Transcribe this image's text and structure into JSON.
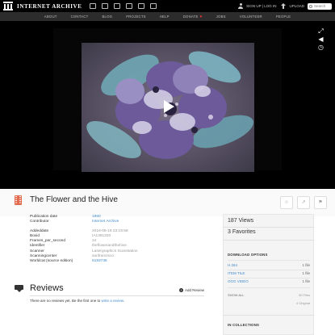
{
  "header": {
    "logo_text": "INTERNET ARCHIVE",
    "media_icons": [
      "web-icon",
      "texts-icon",
      "video-icon",
      "audio-icon",
      "software-icon",
      "images-icon"
    ],
    "signup_label": "SIGN UP | LOG IN",
    "upload_label": "UPLOAD",
    "search_placeholder": "Search"
  },
  "nav": {
    "items": [
      "ABOUT",
      "CONTACT",
      "BLOG",
      "PROJECTS",
      "HELP",
      "DONATE",
      "JOBS",
      "VOLUNTEER",
      "PEOPLE"
    ],
    "donate_heart": "♥"
  },
  "item": {
    "title": "The Flower and the Hive",
    "actions": [
      "favorite-icon",
      "share-icon",
      "flag-icon"
    ]
  },
  "metadata": [
    {
      "k": "Publication date",
      "v": "1960",
      "link": true
    },
    {
      "k": "Contributor",
      "v": "Internet Archive",
      "link": true
    },
    {
      "gap": true
    },
    {
      "k": "Addeddate",
      "v": "2018-08-19 23:19:58",
      "link": false
    },
    {
      "k": "Boxid",
      "v": "IA1381320",
      "link": false
    },
    {
      "k": "Frames_per_second",
      "v": "24",
      "link": false
    },
    {
      "k": "Identifier",
      "v": "theflowerandthehive",
      "link": false
    },
    {
      "k": "Scanner",
      "v": "Lasergraphics Scanstation",
      "link": false
    },
    {
      "k": "Scanningcenter",
      "v": "sanfrancisco",
      "link": false
    },
    {
      "k": "Worldcat (source edition)",
      "v": "5193736",
      "link": true
    }
  ],
  "stats": {
    "views": "187 Views",
    "favorites": "3 Favorites"
  },
  "downloads": {
    "heading": "DOWNLOAD OPTIONS",
    "rows": [
      {
        "name": "H.264",
        "count": "1 file"
      },
      {
        "name": "ITEM TILE",
        "count": "1 file"
      },
      {
        "name": "OGG VIDEO",
        "count": "1 file"
      }
    ],
    "show_all": "SHOW ALL",
    "files_total": "30 Files",
    "original_total": "4 Original"
  },
  "collections": {
    "heading": "IN COLLECTIONS"
  },
  "reviews": {
    "title": "Reviews",
    "add_label": "Add Review",
    "empty_text": "There are no reviews yet. Be the first one to ",
    "empty_link": "write a review",
    "empty_end": "."
  }
}
